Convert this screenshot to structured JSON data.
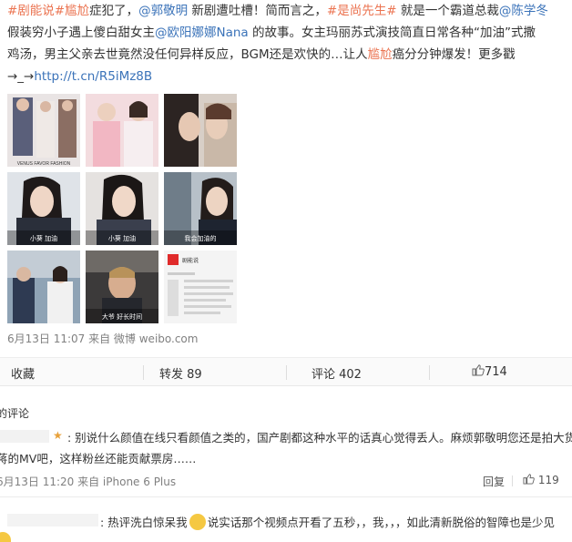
{
  "post": {
    "line1": {
      "tag1": "#剧能说#",
      "tag2": "尴尬",
      "t1": "症犯了，",
      "mention1": "@郭敬明",
      "t2": " 新剧遭吐槽！简而言之，",
      "tag3": "#是尚先生#",
      "t3": " 就是一个霸道总裁",
      "mention2": "@陈学冬"
    },
    "line2": {
      "t1": "假装穷小子遇上傻白甜女主",
      "mention": "@欧阳娜娜Nana",
      "t2": " 的故事。女主玛丽苏式演技简直日常各种“加油”式撒"
    },
    "line3": {
      "t1": "鸡汤，男主父亲去世竟然没任何异样反应，BGM还是欢快的…让人",
      "hl": "尴尬",
      "t2": "癌分分钟爆发！更多戳"
    },
    "line4": {
      "arrow": "→_→",
      "link": "http://t.cn/R5iMz8B"
    },
    "images": [
      {
        "caption": "VENUS FAVOR FASHION"
      },
      {
        "caption": ""
      },
      {
        "caption": ""
      },
      {
        "caption": "小葵 加油"
      },
      {
        "caption": "小葵 加油"
      },
      {
        "caption": "我会加油的"
      },
      {
        "caption": ""
      },
      {
        "caption": "大爷 好长时间"
      },
      {
        "caption": "剧能说"
      }
    ],
    "meta": "6月13日 11:07 来自 微博 weibo.com"
  },
  "actions": {
    "favorite": "收藏",
    "repost": "转发 89",
    "comment": "评论 402",
    "like": "714"
  },
  "comments_title": "的评论",
  "comments": [
    {
      "text1": ": 别说什么颜值在线只看颜值之类的，国产剧都这种水平的话真心觉得丢人。麻烦郭敬明您还是拍大货",
      "text2": "蒋的MV吧，这样粉丝还能贡献票房……",
      "meta": "6月13日 11:20 来自 iPhone 6 Plus",
      "reply": "回复",
      "likes": "119"
    },
    {
      "text1": ": 热评洗白惊呆我",
      "text2": "说实话那个视频点开看了五秒，，我，，，如此清新脱俗的智障也是少见"
    }
  ],
  "colors": {
    "accent": "#eb7350",
    "link": "#3b73b9",
    "meta": "#808080"
  }
}
